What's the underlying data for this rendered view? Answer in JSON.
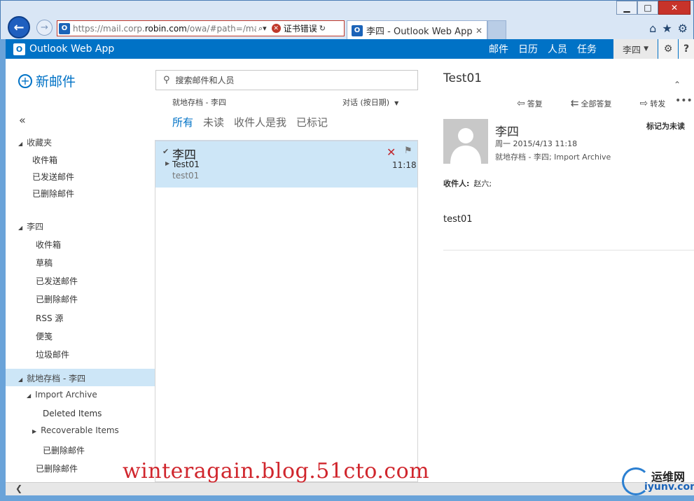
{
  "browser": {
    "window_controls": {
      "minimize": "▁",
      "maximize": "□",
      "close": "✕"
    },
    "address": {
      "url_prefix": "https://mail.corp.",
      "url_domain": "robin.com",
      "url_suffix": "/owa/#path=/ma",
      "cert_error": "证书错误"
    },
    "tab": {
      "title": "李四 - Outlook Web App"
    }
  },
  "owa": {
    "app_name": "Outlook Web App",
    "nav": [
      "邮件",
      "日历",
      "人员",
      "任务"
    ],
    "user": "李四",
    "brand_color": "#0072c6"
  },
  "folders": {
    "new_mail": "新邮件",
    "favorites": {
      "header": "收藏夹",
      "items": [
        "收件箱",
        "已发送邮件",
        "已删除邮件"
      ]
    },
    "mailbox": {
      "header": "李四",
      "items": [
        "收件箱",
        "草稿",
        "已发送邮件",
        "已删除邮件",
        "RSS 源",
        "便笺",
        "垃圾邮件"
      ]
    },
    "archive": {
      "header": "就地存档 - 李四",
      "import": "Import Archive",
      "import_items": [
        "Deleted Items",
        "Recoverable Items",
        "已删除邮件"
      ],
      "bottom_item": "已删除邮件"
    }
  },
  "list": {
    "search_placeholder": "搜索邮件和人员",
    "folder_label": "就地存档 - 李四",
    "sort_label": "对话 (按日期)",
    "filters": [
      "所有",
      "未读",
      "收件人是我",
      "已标记"
    ],
    "messages": [
      {
        "from": "李四",
        "subject": "Test01",
        "preview": "test01",
        "time": "11:18"
      }
    ]
  },
  "reading": {
    "subject": "Test01",
    "actions": [
      "答复",
      "全部答复",
      "转发"
    ],
    "sender": "李四",
    "date": "周一 2015/4/13 11:18",
    "folders": "就地存档 - 李四; Import Archive",
    "mark": "标记为未读",
    "to_label": "收件人:",
    "to": "赵六;",
    "body": "test01"
  },
  "watermark": {
    "text": "winteragain.blog.51cto.com",
    "site_cn": "运维网",
    "site_en": "iyunv.com"
  }
}
